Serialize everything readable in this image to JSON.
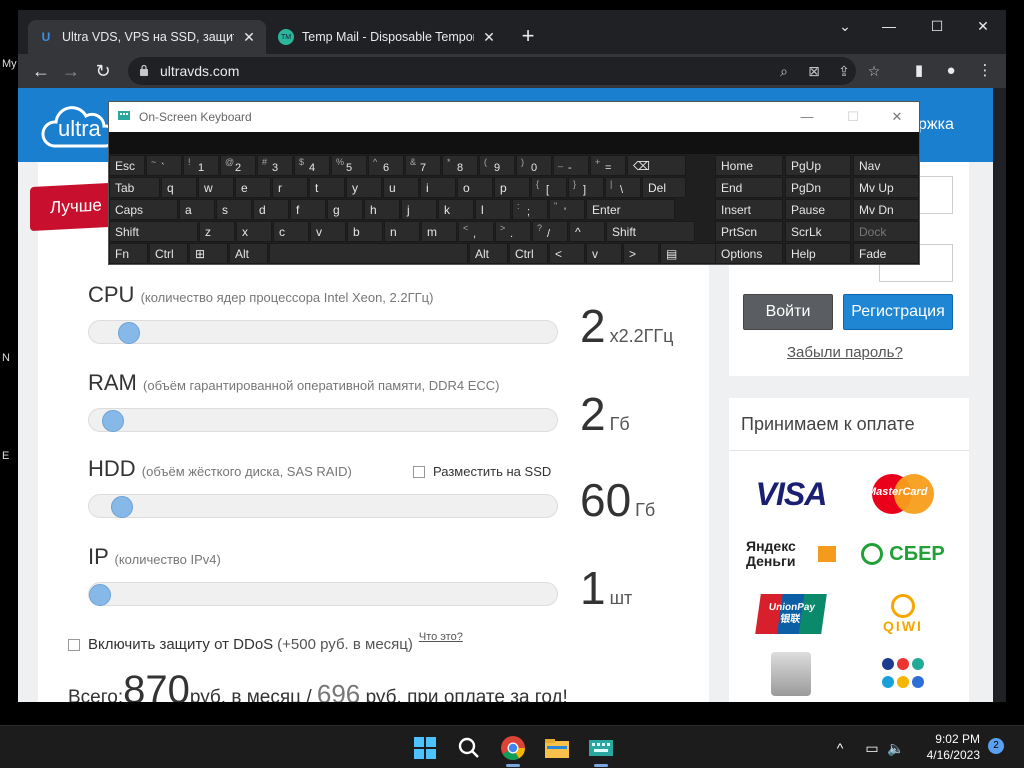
{
  "desktop": {
    "labels": [
      "My",
      "N",
      "E"
    ]
  },
  "browser": {
    "tabs": [
      {
        "title": "Ultra VDS, VPS на SSD, защита о",
        "favicon": "U"
      },
      {
        "title": "Temp Mail - Disposable Tempora",
        "favicon": "TM"
      }
    ],
    "url": "ultravds.com"
  },
  "site": {
    "logo": "ultra",
    "support": "ржка",
    "ribbon": "Лучше"
  },
  "calculator": {
    "resources": [
      {
        "name": "CPU",
        "desc": "(количество ядер процессора Intel Xeon, 2.2ГГц)",
        "value": "2",
        "unit": "x2.2ГГц",
        "level": 0.04
      },
      {
        "name": "RAM",
        "desc": "(объём гарантированной оперативной памяти, DDR4 ECC)",
        "value": "2",
        "unit": "Гб",
        "level": 0.02
      },
      {
        "name": "HDD",
        "desc": "(объём жёсткого диска, SAS RAID)",
        "value": "60",
        "unit": "Гб",
        "level": 0.03
      },
      {
        "name": "IP",
        "desc": "(количество IPv4)",
        "value": "1",
        "unit": "шт",
        "level": 0.0
      }
    ],
    "ssd_label": "Разместить на SSD",
    "ddos_label": "Включить защиту от DDoS",
    "ddos_price": "(+500 руб. в месяц)",
    "ddos_what": "Что это?",
    "total_label": "Всего:",
    "total_value": "870",
    "total_month": "руб. в месяц /",
    "total_year_value": "696",
    "total_year": "руб. при оплате за год!"
  },
  "login": {
    "login_button": "Войти",
    "register_button": "Регистрация",
    "forgot": "Забыли пароль?"
  },
  "payments": {
    "title": "Принимаем к оплате",
    "logos": [
      "VISA",
      "MasterCard",
      "Яндекс Деньги",
      "СБЕР",
      "UnionPay 银联",
      "QIWI"
    ]
  },
  "osk": {
    "title": "On-Screen Keyboard",
    "rows": [
      [
        "Esc",
        "~ `",
        "! 1",
        "@ 2",
        "# 3",
        "$ 4",
        "% 5",
        "^ 6",
        "& 7",
        "* 8",
        "( 9",
        ") 0",
        "_ -",
        "+ =",
        "⌫"
      ],
      [
        "Tab",
        "q",
        "w",
        "e",
        "r",
        "t",
        "y",
        "u",
        "i",
        "o",
        "p",
        "{ [",
        "} ]",
        "| \\",
        "Del"
      ],
      [
        "Caps",
        "a",
        "s",
        "d",
        "f",
        "g",
        "h",
        "j",
        "k",
        "l",
        ": ;",
        "\" '",
        "Enter"
      ],
      [
        "Shift",
        "z",
        "x",
        "c",
        "v",
        "b",
        "n",
        "m",
        "< ,",
        "> .",
        "? /",
        "^",
        "Shift"
      ],
      [
        "Fn",
        "Ctrl",
        "⊞",
        "Alt",
        "",
        "Alt",
        "Ctrl",
        "<",
        "v",
        ">",
        "▤"
      ]
    ],
    "side_keys": [
      [
        "Home",
        "PgUp",
        "Nav"
      ],
      [
        "End",
        "PgDn",
        "Mv Up"
      ],
      [
        "Insert",
        "Pause",
        "Mv Dn"
      ],
      [
        "PrtScn",
        "ScrLk",
        "Dock"
      ],
      [
        "Options",
        "Help",
        "Fade"
      ]
    ]
  },
  "taskbar": {
    "time": "9:02 PM",
    "date": "4/16/2023",
    "notifications": "2"
  }
}
